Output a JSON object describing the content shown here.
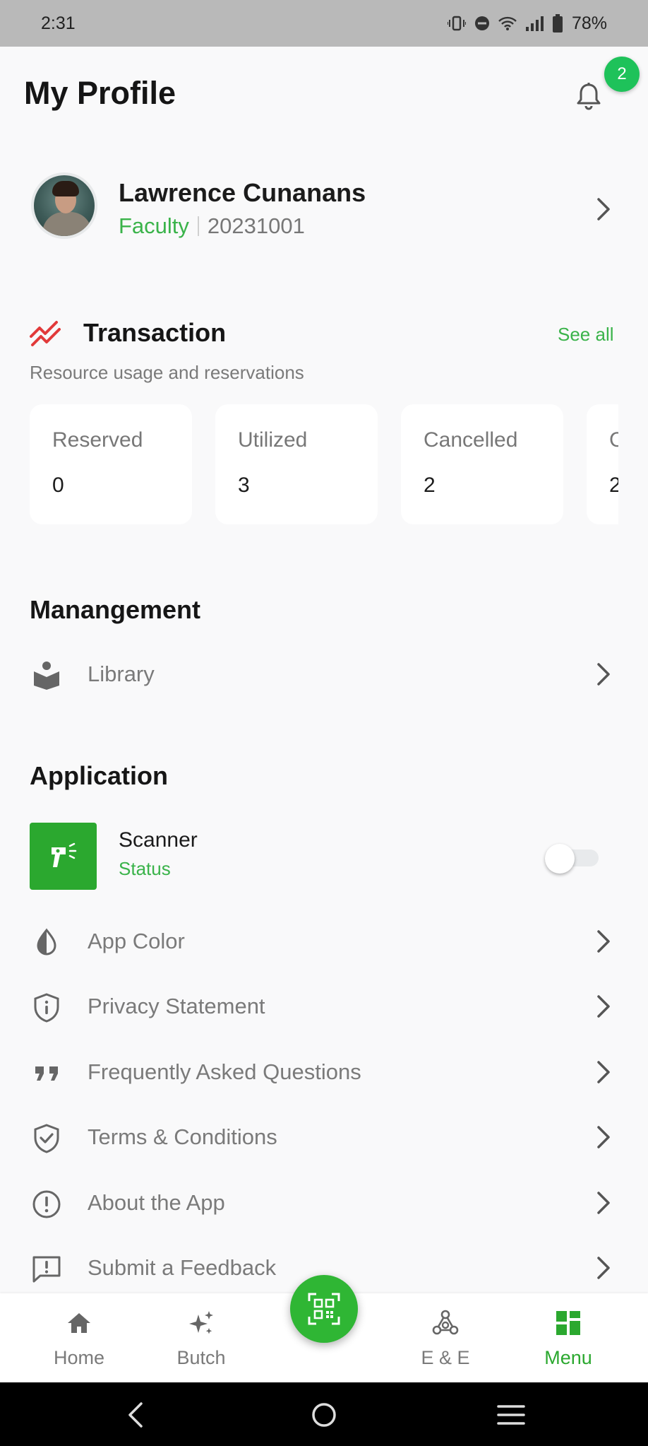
{
  "status_bar": {
    "time": "2:31",
    "battery": "78%"
  },
  "header": {
    "title": "My Profile",
    "notification_count": "2"
  },
  "profile": {
    "name": "Lawrence Cunanans",
    "role": "Faculty",
    "id_number": "20231001"
  },
  "transaction": {
    "title": "Transaction",
    "see_all": "See all",
    "subtitle": "Resource usage and reservations",
    "cards": [
      {
        "label": "Reserved",
        "value": "0"
      },
      {
        "label": "Utilized",
        "value": "3"
      },
      {
        "label": "Cancelled",
        "value": "2"
      },
      {
        "label": "C",
        "value": "2"
      }
    ]
  },
  "management": {
    "title": "Manangement",
    "items": [
      {
        "label": "Library",
        "icon": "book-reader-icon"
      }
    ]
  },
  "application": {
    "title": "Application",
    "scanner": {
      "name": "Scanner",
      "status": "Status",
      "enabled": false
    },
    "items": [
      {
        "label": "App Color",
        "icon": "contrast-icon"
      },
      {
        "label": "Privacy Statement",
        "icon": "shield-info-icon"
      },
      {
        "label": "Frequently Asked Questions",
        "icon": "quote-icon"
      },
      {
        "label": "Terms & Conditions",
        "icon": "shield-check-icon"
      },
      {
        "label": "About the App",
        "icon": "exclamation-circle-icon"
      },
      {
        "label": "Submit a Feedback",
        "icon": "feedback-icon"
      }
    ]
  },
  "bottom_nav": {
    "items": [
      {
        "label": "Home",
        "icon": "home-icon"
      },
      {
        "label": "Butch",
        "icon": "sparkles-icon"
      },
      {
        "label": "E & E",
        "icon": "network-icon"
      },
      {
        "label": "Menu",
        "icon": "grid-icon",
        "active": true
      }
    ],
    "fab_icon": "qr-scan-icon"
  },
  "colors": {
    "accent": "#2ba82f",
    "accent_text": "#3ab34a",
    "background": "#f9f9fa"
  }
}
